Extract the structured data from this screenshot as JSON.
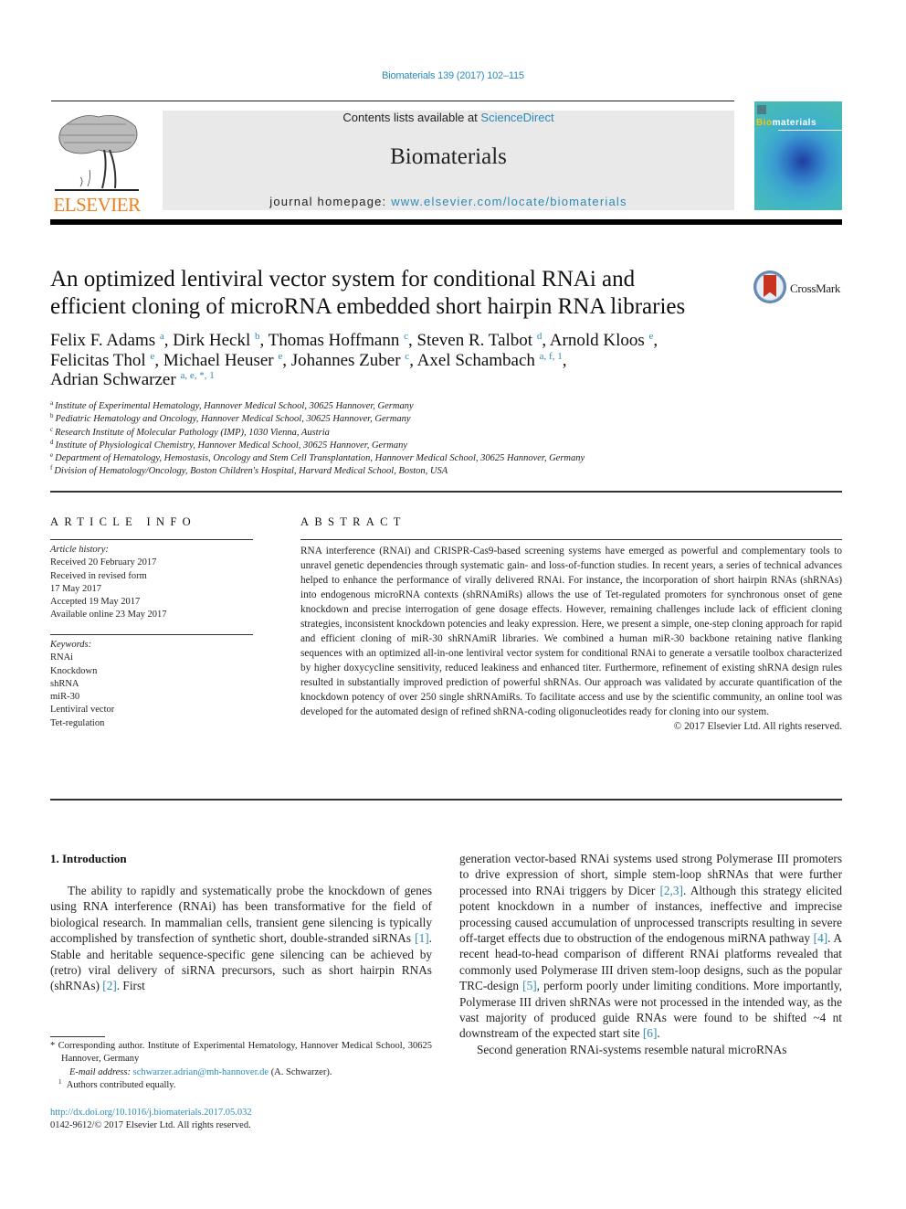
{
  "header": {
    "citation": "Biomaterials 139 (2017) 102–115",
    "publisher_logo_text": "ELSEVIER",
    "contents_prefix": "Contents lists available at ",
    "contents_link": "ScienceDirect",
    "journal_name": "Biomaterials",
    "homepage_prefix": "journal homepage: ",
    "homepage_link": "www.elsevier.com/locate/biomaterials",
    "cover_title_bio": "Bio",
    "cover_title_rest": "materials",
    "colors": {
      "link": "#2a8ab8",
      "elsevier_orange": "#f07f1c",
      "banner_bg": "#e9e9e9"
    }
  },
  "article": {
    "title_line1": "An optimized lentiviral vector system for conditional RNAi and",
    "title_line2": "efficient cloning of microRNA embedded short hairpin RNA libraries",
    "crossmark_label": "CrossMark",
    "authors": [
      {
        "name": "Felix F. Adams",
        "sup": "a",
        "sep": ", "
      },
      {
        "name": "Dirk Heckl",
        "sup": "b",
        "sep": ", "
      },
      {
        "name": "Thomas Hoffmann",
        "sup": "c",
        "sep": ", "
      },
      {
        "name": "Steven R. Talbot",
        "sup": "d",
        "sep": ", "
      },
      {
        "name": "Arnold Kloos",
        "sup": "e",
        "sep": ","
      },
      {
        "name": "Felicitas Thol",
        "sup": "e",
        "sep": ", "
      },
      {
        "name": "Michael Heuser",
        "sup": "e",
        "sep": ", "
      },
      {
        "name": "Johannes Zuber",
        "sup": "c",
        "sep": ", "
      },
      {
        "name": "Axel Schambach",
        "sup": "a, f, 1",
        "sep": ","
      },
      {
        "name": "Adrian Schwarzer",
        "sup": "a, e, *, 1",
        "sep": ""
      }
    ],
    "affiliations": [
      {
        "key": "a",
        "text": "Institute of Experimental Hematology, Hannover Medical School, 30625 Hannover, Germany"
      },
      {
        "key": "b",
        "text": "Pediatric Hematology and Oncology, Hannover Medical School, 30625 Hannover, Germany"
      },
      {
        "key": "c",
        "text": "Research Institute of Molecular Pathology (IMP), 1030 Vienna, Austria"
      },
      {
        "key": "d",
        "text": "Institute of Physiological Chemistry, Hannover Medical School, 30625 Hannover, Germany"
      },
      {
        "key": "e",
        "text": "Department of Hematology, Hemostasis, Oncology and Stem Cell Transplantation, Hannover Medical School, 30625 Hannover, Germany"
      },
      {
        "key": "f",
        "text": "Division of Hematology/Oncology, Boston Children's Hospital, Harvard Medical School, Boston, USA"
      }
    ]
  },
  "article_info": {
    "heading": "ARTICLE INFO",
    "history_label": "Article history:",
    "history": [
      "Received 20 February 2017",
      "Received in revised form",
      "17 May 2017",
      "Accepted 19 May 2017",
      "Available online 23 May 2017"
    ],
    "keywords_label": "Keywords:",
    "keywords": [
      "RNAi",
      "Knockdown",
      "shRNA",
      "miR-30",
      "Lentiviral vector",
      "Tet-regulation"
    ]
  },
  "abstract": {
    "heading": "ABSTRACT",
    "text": "RNA interference (RNAi) and CRISPR-Cas9-based screening systems have emerged as powerful and complementary tools to unravel genetic dependencies through systematic gain- and loss-of-function studies. In recent years, a series of technical advances helped to enhance the performance of virally delivered RNAi. For instance, the incorporation of short hairpin RNAs (shRNAs) into endogenous microRNA contexts (shRNAmiRs) allows the use of Tet-regulated promoters for synchronous onset of gene knockdown and precise interrogation of gene dosage effects. However, remaining challenges include lack of efficient cloning strategies, inconsistent knockdown potencies and leaky expression. Here, we present a simple, one-step cloning approach for rapid and efficient cloning of miR-30 shRNAmiR libraries. We combined a human miR-30 backbone retaining native flanking sequences with an optimized all-in-one lentiviral vector system for conditional RNAi to generate a versatile toolbox characterized by higher doxycycline sensitivity, reduced leakiness and enhanced titer. Furthermore, refinement of existing shRNA design rules resulted in substantially improved prediction of powerful shRNAs. Our approach was validated by accurate quantification of the knockdown potency of over 250 single shRNAmiRs. To facilitate access and use by the scientific community, an online tool was developed for the automated design of refined shRNA-coding oligonucleotides ready for cloning into our system.",
    "copyright": "© 2017 Elsevier Ltd. All rights reserved."
  },
  "body": {
    "section_heading": "1.  Introduction",
    "left_para": [
      {
        "t": "The ability to rapidly and systematically probe the knockdown of genes using RNA interference (RNAi) has been transformative for the field of biological research. In mammalian cells, transient gene silencing is typically accomplished by transfection of synthetic short, double-stranded siRNAs "
      },
      {
        "ref": "[1]"
      },
      {
        "t": ". Stable and heritable sequence-specific gene silencing can be achieved by (retro) viral delivery of siRNA precursors, such as short hairpin RNAs (shRNAs) "
      },
      {
        "ref": "[2]"
      },
      {
        "t": ". First"
      }
    ],
    "right_para1": [
      {
        "t": "generation vector-based RNAi systems used strong Polymerase III promoters to drive expression of short, simple stem-loop shRNAs that were further processed into RNAi triggers by Dicer "
      },
      {
        "ref": "[2,3]"
      },
      {
        "t": ". Although this strategy elicited potent knockdown in a number of instances, ineffective and imprecise processing caused accumulation of unprocessed transcripts resulting in severe off-target effects due to obstruction of the endogenous miRNA pathway "
      },
      {
        "ref": "[4]"
      },
      {
        "t": ". A recent head-to-head comparison of different RNAi platforms revealed that commonly used Polymerase III driven stem-loop designs, such as the popular TRC-design "
      },
      {
        "ref": "[5]"
      },
      {
        "t": ", perform poorly under limiting conditions. More importantly, Polymerase III driven shRNAs were not processed in the intended way, as the vast majority of produced guide RNAs were found to be shifted ~4 nt downstream of the expected start site "
      },
      {
        "ref": "[6]"
      },
      {
        "t": "."
      }
    ],
    "right_para2": "Second generation RNAi-systems resemble natural microRNAs"
  },
  "footnotes": {
    "corresponding": "* Corresponding author. Institute of Experimental Hematology, Hannover Medical School, 30625 Hannover, Germany",
    "email_label": "E-mail address: ",
    "email": "schwarzer.adrian@mh-hannover.de",
    "email_suffix": " (A. Schwarzer).",
    "equal_mark": "1",
    "equal_text": "Authors contributed equally.",
    "doi": "http://dx.doi.org/10.1016/j.biomaterials.2017.05.032",
    "issn": "0142-9612/© 2017 Elsevier Ltd. All rights reserved."
  }
}
